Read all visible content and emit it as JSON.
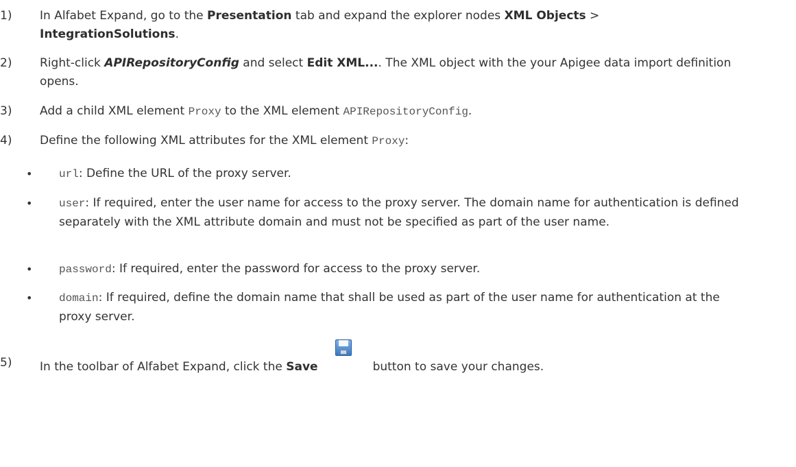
{
  "steps": [
    {
      "number": "1)",
      "parts": {
        "a": "In Alfabet Expand, go to the ",
        "b": "Presentation",
        "c": " tab and expand the explorer nodes ",
        "d": "XML Objects",
        "e": " > ",
        "f": "IntegrationSolutions",
        "g": "."
      }
    },
    {
      "number": "2)",
      "parts": {
        "a": "Right-click ",
        "b": "APIRepositoryConfig",
        "c": " and select ",
        "d": "Edit XML...",
        "e": ". The XML object with the your Apigee data import definition opens."
      }
    },
    {
      "number": "3)",
      "parts": {
        "a": "Add a child XML element ",
        "b": "Proxy",
        "c": " to the XML element ",
        "d": "APIRepositoryConfig",
        "e": "."
      }
    },
    {
      "number": "4)",
      "parts": {
        "a": "Define the following XML attributes for the XML element ",
        "b": "Proxy",
        "c": ":"
      }
    },
    {
      "number": "5)",
      "parts": {
        "a": "In the toolbar of Alfabet Expand, click the ",
        "b": "Save",
        "c": "button to save your changes."
      }
    }
  ],
  "bullets": [
    {
      "symbol": "•",
      "code": "url",
      "text": ": Define the URL of the proxy server."
    },
    {
      "symbol": "•",
      "code": "user",
      "text": ": If required, enter the user name for access to the proxy server. The domain name for authentication is defined separately with the XML attribute domain and must not be specified as part of the user name."
    },
    {
      "symbol": "•",
      "code": "password",
      "text": ": If required, enter the password for access to the proxy server."
    },
    {
      "symbol": "•",
      "code": "domain",
      "text": ": If required, define the domain name that shall be used as part of the user name for authentication at the proxy server."
    }
  ],
  "icons": {
    "save": "save-icon"
  },
  "colors": {
    "text": "#333333",
    "code": "#555555",
    "save_icon": "#3b78c4"
  }
}
